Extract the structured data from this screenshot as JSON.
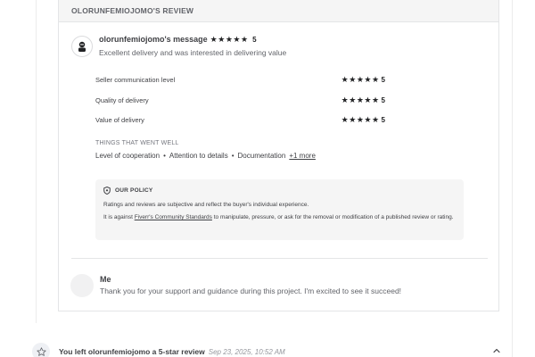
{
  "review": {
    "header": "OLORUNFEMIOJOMO'S REVIEW",
    "reviewer_message_label": "olorunfemiojomo's message",
    "overall_rating": "5",
    "message": "Excellent delivery and was interested in delivering value",
    "ratings": [
      {
        "label": "Seller communication level",
        "value": "5"
      },
      {
        "label": "Quality of delivery",
        "value": "5"
      },
      {
        "label": "Value of delivery",
        "value": "5"
      }
    ],
    "went_well": {
      "title": "THINGS THAT WENT WELL",
      "items": [
        "Level of cooperation",
        "Attention to details",
        "Documentation"
      ],
      "more": "+1 more"
    },
    "policy": {
      "title": "OUR POLICY",
      "line1": "Ratings and reviews are subjective and reflect the buyer's individual experience.",
      "line2_prefix": "It is against ",
      "line2_link": "Fiverr's Community Standards",
      "line2_suffix": " to manipulate, pressure, or ask for the removal or modification of a published review or rating."
    }
  },
  "reply": {
    "name": "Me",
    "text": "Thank you for your support and guidance during this project. I'm excited to see it succeed!"
  },
  "activity": {
    "text": "You left olorunfemiojomo a 5-star review",
    "time": "Sep 23, 2025, 10:52 AM",
    "icon": "star-outline-icon"
  },
  "colors": {
    "text": "#404145",
    "muted": "#62646a",
    "star": "#222325",
    "header_bg": "#f5f5f5"
  }
}
